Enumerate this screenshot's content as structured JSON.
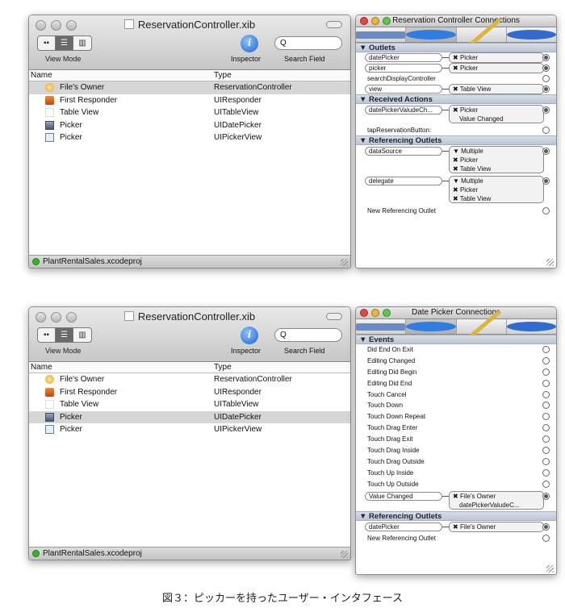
{
  "xib_window": {
    "title": "ReservationController.xib",
    "toolbar": {
      "view_mode_label": "View Mode",
      "inspector_label": "Inspector",
      "search_field_label": "Search Field",
      "inspector_glyph": "i",
      "search_glyph": "Q"
    },
    "columns": {
      "name": "Name",
      "type": "Type"
    },
    "rows": [
      {
        "name": "File's Owner",
        "type": "ReservationController",
        "icon": "owner"
      },
      {
        "name": "First Responder",
        "type": "UIResponder",
        "icon": "resp"
      },
      {
        "name": "Table View",
        "type": "UITableView",
        "icon": "blank"
      },
      {
        "name": "Picker",
        "type": "UIDatePicker",
        "icon": "date"
      },
      {
        "name": "Picker",
        "type": "UIPickerView",
        "icon": "pick"
      }
    ],
    "status": "PlantRentalSales.xcodeproj"
  },
  "reservation_connections": {
    "title": "Reservation Controller Connections",
    "sections": {
      "outlets": "Outlets",
      "received_actions": "Received Actions",
      "referencing_outlets": "Referencing Outlets"
    },
    "outlets": [
      {
        "name": "datePicker",
        "target": "Picker"
      },
      {
        "name": "picker",
        "target": "Picker"
      },
      {
        "name": "searchDisplayController",
        "target": ""
      },
      {
        "name": "view",
        "target": "Table View"
      }
    ],
    "actions": [
      {
        "name": "datePickerValudeCh...",
        "target": "Picker",
        "event": "Value Changed"
      },
      {
        "name": "tapReservationButton:",
        "target": ""
      }
    ],
    "referencing": [
      {
        "name": "dataSource",
        "targets": [
          "Multiple",
          "Picker",
          "Table View"
        ]
      },
      {
        "name": "delegate",
        "targets": [
          "Multiple",
          "Picker",
          "Table View"
        ]
      },
      {
        "name": "New Referencing Outlet",
        "targets": []
      }
    ]
  },
  "datepicker_connections": {
    "title": "Date Picker Connections",
    "sections": {
      "events": "Events",
      "referencing_outlets": "Referencing Outlets"
    },
    "events": [
      "Did End On Exit",
      "Editing Changed",
      "Editing Did Begin",
      "Editing Did End",
      "Touch Cancel",
      "Touch Down",
      "Touch Down Repeat",
      "Touch Drag Enter",
      "Touch Drag Exit",
      "Touch Drag Inside",
      "Touch Drag Outside",
      "Touch Up Inside",
      "Touch Up Outside"
    ],
    "value_changed": {
      "name": "Value Changed",
      "target": "File's Owner",
      "method": "datePickerValudeC..."
    },
    "referencing": [
      {
        "name": "datePicker",
        "target": "File's Owner"
      },
      {
        "name": "New Referencing Outlet",
        "target": ""
      }
    ]
  },
  "caption": "図３：ピッカーを持ったユーザー・インタフェース"
}
